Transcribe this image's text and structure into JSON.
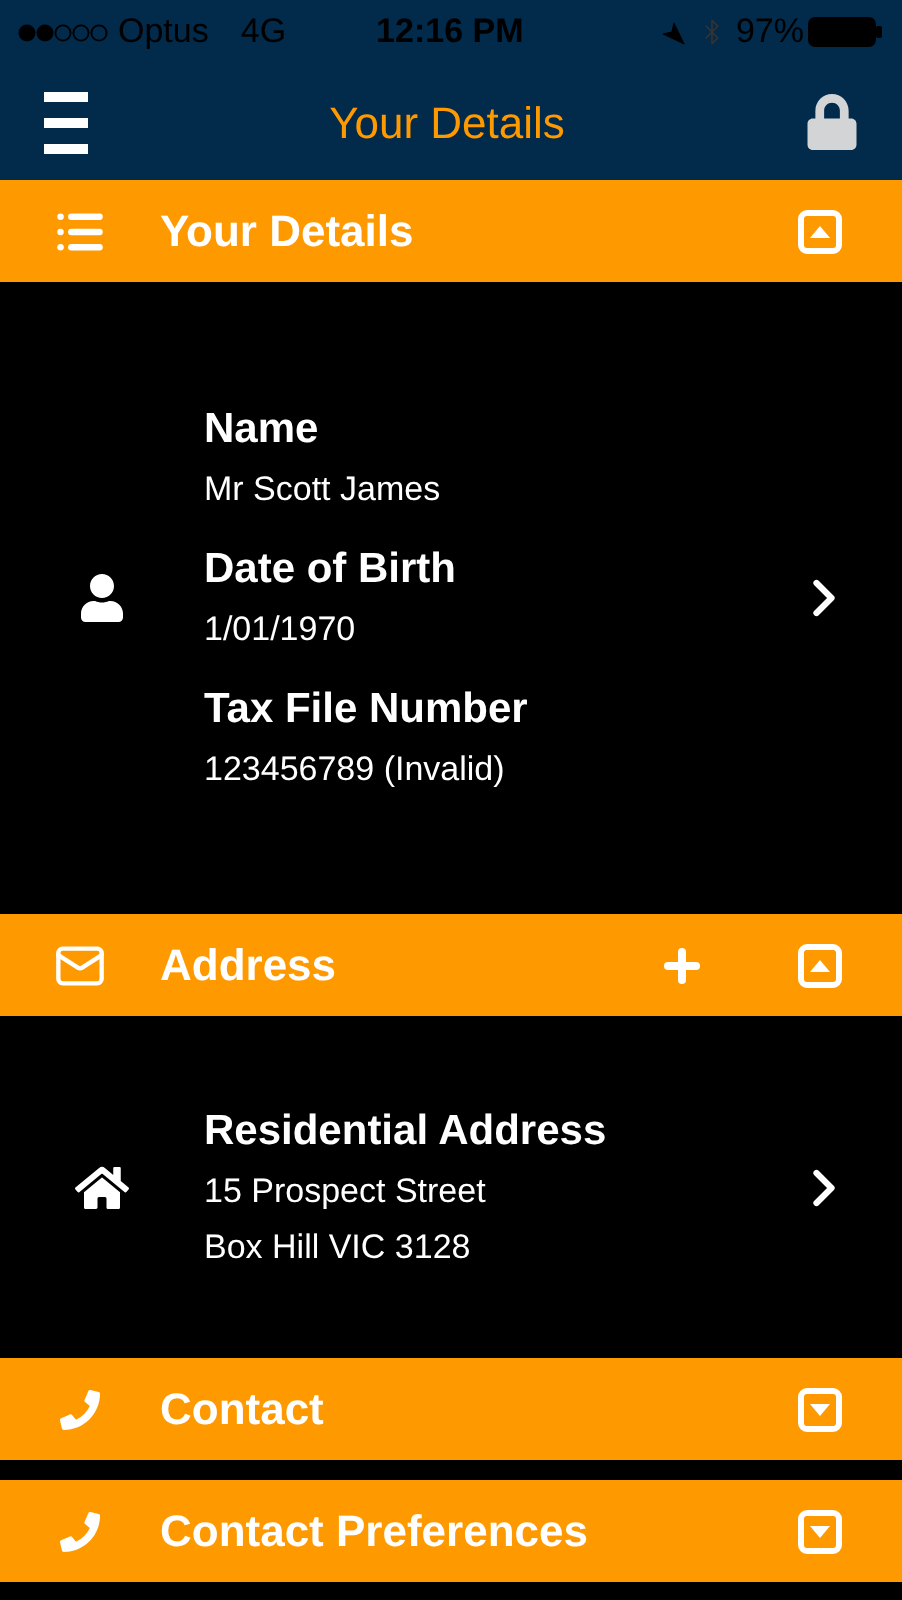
{
  "status_bar": {
    "carrier": "Optus",
    "network": "4G",
    "time": "12:16 PM",
    "battery": "97%"
  },
  "nav": {
    "title": "Your Details"
  },
  "sections": [
    {
      "kind": "details",
      "title": "Your Details",
      "expanded": true,
      "can_add": false,
      "entries": [
        {
          "kind": "person",
          "fields": [
            {
              "label": "Name",
              "lines": [
                "Mr Scott James"
              ]
            },
            {
              "label": "Date of Birth",
              "lines": [
                "1/01/1970"
              ]
            },
            {
              "label": "Tax File Number",
              "lines": [
                "123456789 (Invalid)"
              ]
            }
          ]
        }
      ]
    },
    {
      "kind": "address",
      "title": "Address",
      "expanded": true,
      "can_add": true,
      "entries": [
        {
          "kind": "home",
          "fields": [
            {
              "label": "Residential Address",
              "lines": [
                "15 Prospect Street",
                "Box Hill VIC 3128"
              ]
            }
          ]
        }
      ]
    },
    {
      "kind": "contact",
      "title": "Contact",
      "expanded": false,
      "can_add": false
    },
    {
      "kind": "contact",
      "title": "Contact Preferences",
      "expanded": false,
      "can_add": false
    }
  ]
}
